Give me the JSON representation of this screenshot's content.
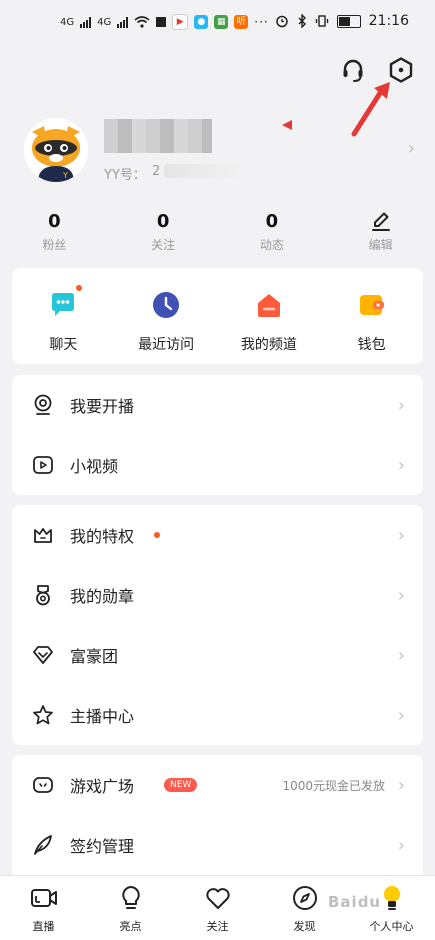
{
  "status_bar": {
    "signal_labels": [
      "4G",
      "4G"
    ],
    "time": "21:16",
    "app_badge": "听"
  },
  "profile": {
    "yy_label": "YY号：",
    "yy_prefix": "2"
  },
  "stats": [
    {
      "num": "0",
      "label": "粉丝"
    },
    {
      "num": "0",
      "label": "关注"
    },
    {
      "num": "0",
      "label": "动态"
    },
    {
      "num": "",
      "label": "编辑"
    }
  ],
  "quick": [
    {
      "label": "聊天"
    },
    {
      "label": "最近访问"
    },
    {
      "label": "我的频道"
    },
    {
      "label": "钱包"
    }
  ],
  "group1": [
    {
      "label": "我要开播"
    },
    {
      "label": "小视频"
    }
  ],
  "group2": [
    {
      "label": "我的特权"
    },
    {
      "label": "我的勋章"
    },
    {
      "label": "富豪团"
    },
    {
      "label": "主播中心"
    }
  ],
  "group3": [
    {
      "label": "游戏广场",
      "badge": "NEW",
      "right": "1000元现金已发放"
    },
    {
      "label": "签约管理"
    }
  ],
  "tabbar": [
    {
      "label": "直播"
    },
    {
      "label": "亮点"
    },
    {
      "label": "关注"
    },
    {
      "label": "发现"
    },
    {
      "label": "个人中心"
    }
  ],
  "chevron": "›",
  "watermark": "Baidu",
  "colors": {
    "accent": "#ff5722",
    "annotation": "#e53935",
    "chat": "#26c6da",
    "recent": "#3f51b5",
    "channel": "#ff5a3c",
    "wallet": "#ffb300",
    "new_badge": "#ff5a4e"
  }
}
